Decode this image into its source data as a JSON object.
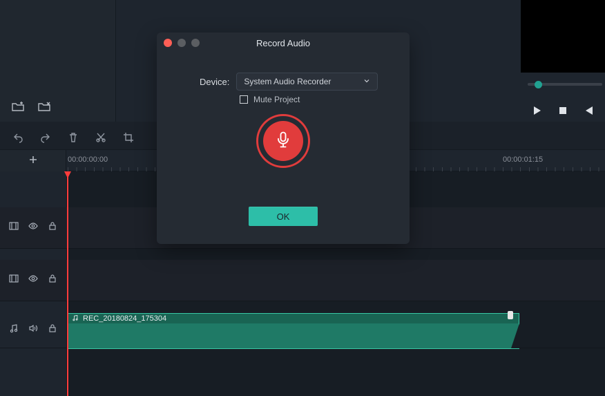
{
  "dialog": {
    "title": "Record Audio",
    "device_label": "Device:",
    "device_value": "System Audio Recorder",
    "mute_label": "Mute Project",
    "mute_checked": false,
    "ok_label": "OK"
  },
  "timeline": {
    "timecodes": [
      "00:00:00:00",
      "00:00:01:15"
    ],
    "clip_name": "REC_20180824_175304"
  },
  "icons": {
    "folder_add": "folder-add-icon",
    "folder_remove": "folder-remove-icon",
    "play": "play-icon",
    "stop": "stop-icon",
    "step": "step-back-icon"
  }
}
